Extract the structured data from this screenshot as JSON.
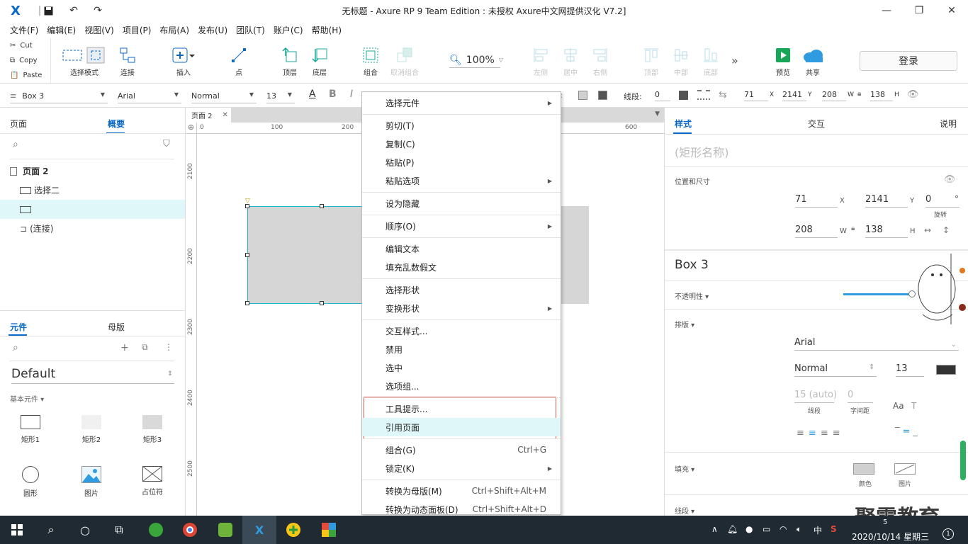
{
  "window": {
    "title": "无标题 - Axure RP 9 Team Edition : 未授权    Axure中文网提供汉化 V7.2]"
  },
  "menubar": [
    "文件(F)",
    "编辑(E)",
    "视图(V)",
    "项目(P)",
    "布局(A)",
    "发布(U)",
    "团队(T)",
    "账户(C)",
    "帮助(H)"
  ],
  "clipboard": {
    "cut": "Cut",
    "copy": "Copy",
    "paste": "Paste"
  },
  "toolbar": {
    "select_mode": "选择模式",
    "connect": "连接",
    "insert": "插入",
    "point": "点",
    "top_layer": "顶层",
    "bottom_layer": "底层",
    "group": "组合",
    "ungroup": "取消组合",
    "zoom": "100%",
    "align_left": "左侧",
    "align_center": "居中",
    "align_right": "右侧",
    "align_top": "顶部",
    "align_middle": "中部",
    "align_bottom": "底部",
    "preview": "预览",
    "share": "共享",
    "login": "登录"
  },
  "formatbar": {
    "widget_name": "Box 3",
    "font": "Arial",
    "weight": "Normal",
    "size": "13",
    "line_label": "线段:",
    "line_value": "0",
    "x": "71",
    "y": "2141",
    "w": "208",
    "h": "138"
  },
  "left": {
    "tabs": [
      "页面",
      "概要"
    ],
    "outline": {
      "page": "页面 2",
      "item1": "选择二",
      "item3": "(连接)"
    },
    "lib_tabs": [
      "元件",
      "母版"
    ],
    "library": "Default",
    "basic_section": "基本元件 ▾",
    "widgets": [
      "矩形1",
      "矩形2",
      "矩形3",
      "圆形",
      "图片",
      "占位符"
    ]
  },
  "canvas": {
    "page_tab": "页面 2",
    "hruler": [
      "0",
      "100",
      "200",
      "600"
    ],
    "vruler": [
      "2100",
      "2200",
      "2300",
      "2400",
      "2500"
    ]
  },
  "context_menu": {
    "items": [
      {
        "label": "选择元件",
        "sub": true
      },
      {
        "label": "剪切(T)"
      },
      {
        "label": "复制(C)"
      },
      {
        "label": "粘贴(P)"
      },
      {
        "label": "粘贴选项",
        "sub": true
      },
      {
        "label": "设为隐藏"
      },
      {
        "label": "顺序(O)",
        "sub": true
      },
      {
        "label": "编辑文本"
      },
      {
        "label": "填充乱数假文"
      },
      {
        "label": "选择形状"
      },
      {
        "label": "变换形状",
        "sub": true
      },
      {
        "label": "交互样式..."
      },
      {
        "label": "禁用"
      },
      {
        "label": "选中"
      },
      {
        "label": "选项组..."
      },
      {
        "label": "工具提示..."
      },
      {
        "label": "引用页面"
      },
      {
        "label": "组合(G)",
        "shortcut": "Ctrl+G"
      },
      {
        "label": "锁定(K)",
        "sub": true
      },
      {
        "label": "转换为母版(M)",
        "shortcut": "Ctrl+Shift+Alt+M"
      },
      {
        "label": "转换为动态面板(D)",
        "shortcut": "Ctrl+Shift+Alt+D"
      }
    ]
  },
  "right": {
    "tabs": [
      "样式",
      "交互",
      "说明"
    ],
    "shape_name_placeholder": "(矩形名称)",
    "pos_size_label": "位置和尺寸",
    "x": "71",
    "y": "2141",
    "rotate": "0",
    "rotate_unit": "°",
    "rotate_label": "旋转",
    "w": "208",
    "h": "138",
    "x_unit": "X",
    "y_unit": "Y",
    "w_unit": "W",
    "h_unit": "H",
    "widget_name": "Box 3",
    "opacity_label": "不透明性 ▾",
    "typography_label": "排版 ▾",
    "font": "Arial",
    "weight": "Normal",
    "size": "13",
    "line_spacing": "15 (auto)",
    "letter_spacing": "0",
    "line_spacing_label": "线段",
    "letter_spacing_label": "字间距",
    "fill_label": "填充 ▾",
    "fill_color_label": "颜色",
    "fill_image_label": "图片",
    "stroke_label": "线段 ▾"
  },
  "watermark": "聚需教育",
  "taskbar": {
    "time": "5",
    "date": "2020/10/14 星期三",
    "ime": "中"
  },
  "colors": {
    "accent": "#0b6ac9",
    "selection": "#1fb7c9",
    "highlight_row": "#e0f7f9",
    "red_frame": "#e05a5a"
  }
}
